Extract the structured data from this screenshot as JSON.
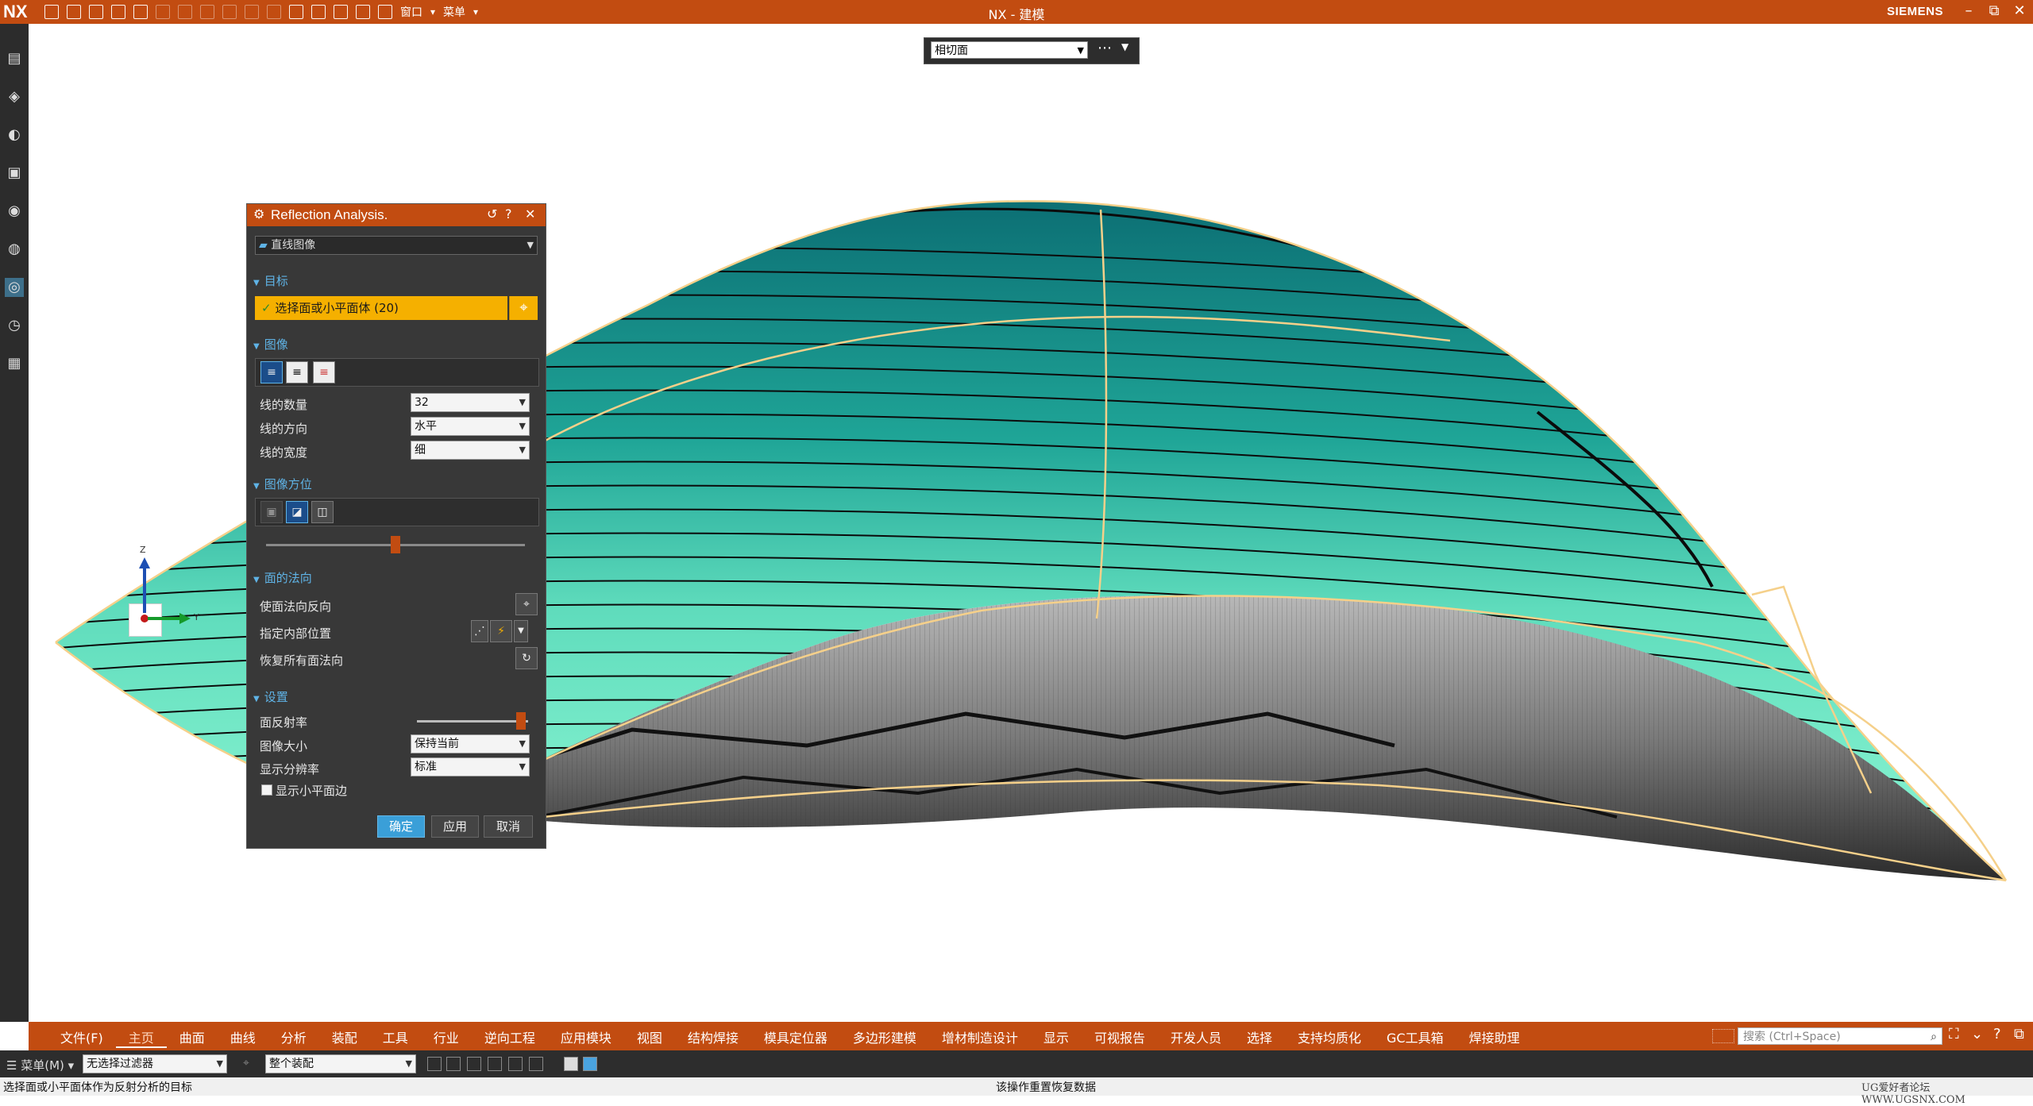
{
  "window": {
    "app_logo": "NX",
    "title": "NX - 建模",
    "brand": "SIEMENS",
    "quick_access": {
      "window_menu": "窗口",
      "menu": "菜单"
    },
    "controls": {
      "minimize": "–",
      "restore": "⧉",
      "close": "✕"
    }
  },
  "section_toolbar": {
    "mode": "相切面",
    "more": "⋯"
  },
  "dialog": {
    "title": "Reflection Analysis.",
    "type_select": "直线图像",
    "target": {
      "header": "目标",
      "selection": "选择面或小平面体 (20)"
    },
    "image": {
      "header": "图像",
      "line_count_label": "线的数量",
      "line_count": "32",
      "line_direction_label": "线的方向",
      "line_direction": "水平",
      "line_width_label": "线的宽度",
      "line_width": "细"
    },
    "orientation": {
      "header": "图像方位",
      "slider_value": 0.5
    },
    "face_normal": {
      "header": "面的法向",
      "reverse_label": "使面法向反向",
      "inner_label": "指定内部位置",
      "restore_label": "恢复所有面法向"
    },
    "settings": {
      "header": "设置",
      "reflectivity_label": "面反射率",
      "reflectivity_value": 0.98,
      "image_size_label": "图像大小",
      "image_size": "保持当前",
      "resolution_label": "显示分辨率",
      "resolution": "标准",
      "show_facet_edges_label": "显示小平面边"
    },
    "buttons": {
      "ok": "确定",
      "apply": "应用",
      "cancel": "取消"
    }
  },
  "triad": {
    "z": "Z",
    "y": "Y"
  },
  "ribbon_tabs": [
    "文件(F)",
    "主页",
    "曲面",
    "曲线",
    "分析",
    "装配",
    "工具",
    "行业",
    "逆向工程",
    "应用模块",
    "视图",
    "结构焊接",
    "模具定位器",
    "多边形建模",
    "增材制造设计",
    "显示",
    "可视报告",
    "开发人员",
    "选择",
    "支持均质化",
    "GC工具箱",
    "焊接助理"
  ],
  "active_tab": "主页",
  "search_placeholder": "搜索 (Ctrl+Space)",
  "selection_bar": {
    "menu": "菜单(M)",
    "filter": "无选择过滤器",
    "scope": "整个装配"
  },
  "status": {
    "left": "选择面或小平面体作为反射分析的目标",
    "center": "该操作重置恢复数据",
    "right": "UG爱好者论坛 WWW.UGSNX.COM"
  },
  "colors": {
    "accent": "#c24c11",
    "surface_top": "#0f7f83",
    "surface_bottom": "#7ff5cf",
    "target_highlight": "#f5b000",
    "section_header": "#5fb3e6"
  }
}
